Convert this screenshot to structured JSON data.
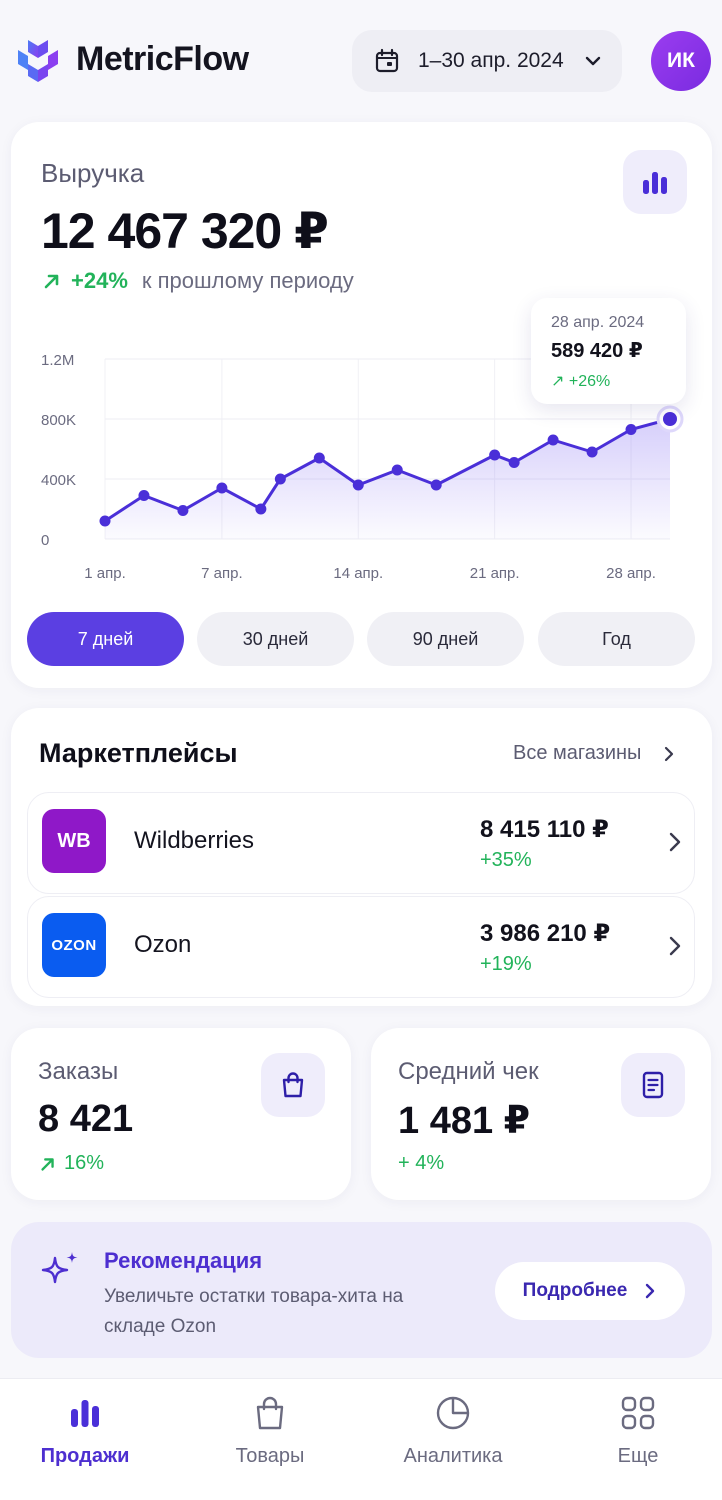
{
  "app": {
    "name": "MetricFlow"
  },
  "header": {
    "date_range": "1–30 апр. 2024",
    "avatar_initials": "ИК"
  },
  "revenue": {
    "title": "Выручка",
    "amount": "12 467 320 ₽",
    "delta": "+24%",
    "delta_label": "к прошлому периоду",
    "tooltip": {
      "date": "28 апр. 2024",
      "value": "589 420 ₽",
      "change": "↗ +26%"
    },
    "ranges": [
      "7 дней",
      "30 дней",
      "90 дней",
      "Год"
    ],
    "active_range": "7 дней"
  },
  "chart_data": {
    "type": "area",
    "x": [
      "1 апр.",
      "3 апр.",
      "5 апр.",
      "7 апр.",
      "9 апр.",
      "10 апр.",
      "12 апр.",
      "14 апр.",
      "16 апр.",
      "18 апр.",
      "21 апр.",
      "22 апр.",
      "24 апр.",
      "26 апр.",
      "28 апр.",
      "30 апр."
    ],
    "values": [
      120000,
      290000,
      190000,
      340000,
      200000,
      400000,
      540000,
      360000,
      460000,
      360000,
      560000,
      510000,
      660000,
      580000,
      730000,
      800000
    ],
    "xticks": [
      "1 апр.",
      "7 апр.",
      "14 апр.",
      "21 апр.",
      "28 апр."
    ],
    "yticks": [
      "0",
      "400K",
      "800K",
      "1.2M"
    ],
    "ylim": [
      0,
      1200000
    ],
    "grid": true,
    "color": "#4a2fd8"
  },
  "marketplaces": {
    "title": "Маркетплейсы",
    "all_label": "Все магазины",
    "items": [
      {
        "name": "Wildberries",
        "logo": "WB",
        "amount": "8 415 110 ₽",
        "delta": "+35%",
        "color": "#8f18c8"
      },
      {
        "name": "Ozon",
        "logo": "OZON",
        "amount": "3 986 210 ₽",
        "delta": "+19%",
        "color": "#0a5cf0"
      }
    ]
  },
  "kpis": {
    "orders": {
      "title": "Заказы",
      "value": "8 421",
      "delta": "16%"
    },
    "avg_check": {
      "title": "Средний чек",
      "value": "1 481 ₽",
      "delta": "+ 4%"
    }
  },
  "recommendation": {
    "title": "Рекомендация",
    "text": "Увеличьте остатки товара-хита на складе Ozon",
    "button": "Подробнее"
  },
  "nav": {
    "items": [
      {
        "label": "Продажи",
        "icon": "bar-chart-icon"
      },
      {
        "label": "Товары",
        "icon": "bag-icon"
      },
      {
        "label": "Аналитика",
        "icon": "pie-chart-icon"
      },
      {
        "label": "Еще",
        "icon": "grid-icon"
      }
    ]
  }
}
